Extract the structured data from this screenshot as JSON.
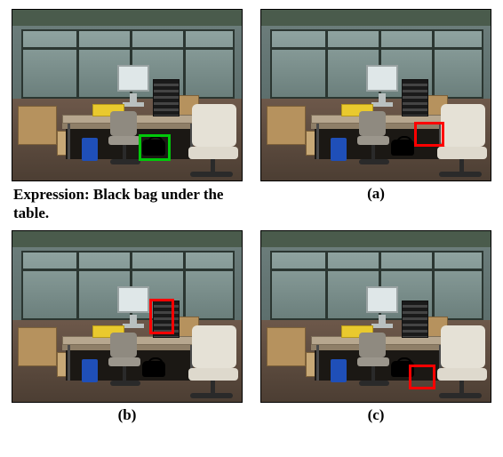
{
  "expression_prefix": "Expression: ",
  "expression_text": "Black bag under the table.",
  "panels": {
    "gt": {
      "label": "",
      "box_color": "#00c80a"
    },
    "a": {
      "label": "(a)",
      "box_color": "#ff0000"
    },
    "b": {
      "label": "(b)",
      "box_color": "#ff0000"
    },
    "c": {
      "label": "(c)",
      "box_color": "#ff0000"
    }
  }
}
